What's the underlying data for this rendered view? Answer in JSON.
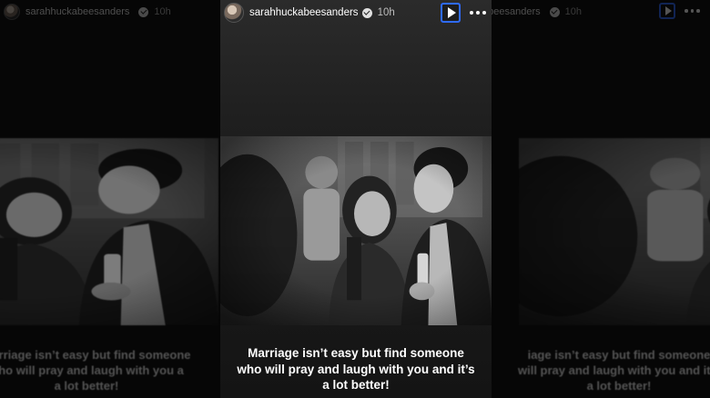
{
  "story": {
    "username": "sarahhuckabeesanders",
    "time": "10h",
    "caption_lines": [
      "Marriage isn’t easy but find someone",
      "who will pray and laugh with you and it’s",
      "a lot better!"
    ]
  },
  "left_preview": {
    "username": "sarahhuckabeesanders",
    "time": "10h",
    "caption_lines": [
      "Marriage isn’t easy but find someone",
      "who will pray and laugh with you a",
      "a lot better!"
    ]
  },
  "right_preview": {
    "username": "ckabeesanders",
    "time": "10h",
    "caption_lines": [
      "iage isn’t easy but find someone",
      "will pray and laugh with you and it’s",
      "a lot better!"
    ]
  },
  "icons": {
    "play": "play-icon",
    "more": "more-horizontal-icon",
    "verified": "verified-badge-icon"
  },
  "colors": {
    "accent_focus": "#2f6bff",
    "background": "#000000"
  }
}
